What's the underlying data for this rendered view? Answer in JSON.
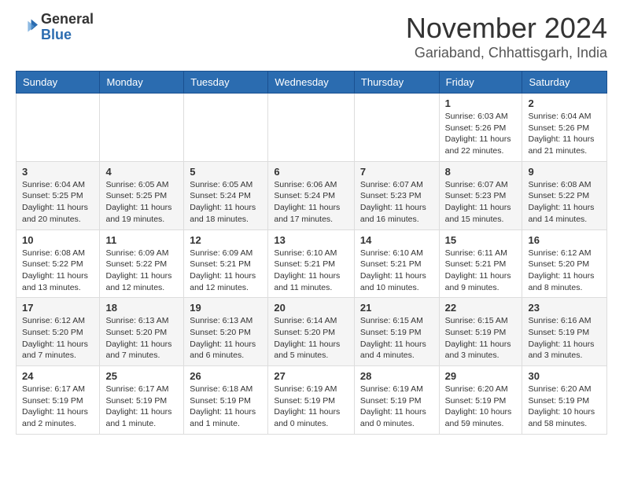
{
  "logo": {
    "general": "General",
    "blue": "Blue"
  },
  "header": {
    "month": "November 2024",
    "location": "Gariaband, Chhattisgarh, India"
  },
  "weekdays": [
    "Sunday",
    "Monday",
    "Tuesday",
    "Wednesday",
    "Thursday",
    "Friday",
    "Saturday"
  ],
  "weeks": [
    [
      {
        "day": "",
        "info": ""
      },
      {
        "day": "",
        "info": ""
      },
      {
        "day": "",
        "info": ""
      },
      {
        "day": "",
        "info": ""
      },
      {
        "day": "",
        "info": ""
      },
      {
        "day": "1",
        "info": "Sunrise: 6:03 AM\nSunset: 5:26 PM\nDaylight: 11 hours and 22 minutes."
      },
      {
        "day": "2",
        "info": "Sunrise: 6:04 AM\nSunset: 5:26 PM\nDaylight: 11 hours and 21 minutes."
      }
    ],
    [
      {
        "day": "3",
        "info": "Sunrise: 6:04 AM\nSunset: 5:25 PM\nDaylight: 11 hours and 20 minutes."
      },
      {
        "day": "4",
        "info": "Sunrise: 6:05 AM\nSunset: 5:25 PM\nDaylight: 11 hours and 19 minutes."
      },
      {
        "day": "5",
        "info": "Sunrise: 6:05 AM\nSunset: 5:24 PM\nDaylight: 11 hours and 18 minutes."
      },
      {
        "day": "6",
        "info": "Sunrise: 6:06 AM\nSunset: 5:24 PM\nDaylight: 11 hours and 17 minutes."
      },
      {
        "day": "7",
        "info": "Sunrise: 6:07 AM\nSunset: 5:23 PM\nDaylight: 11 hours and 16 minutes."
      },
      {
        "day": "8",
        "info": "Sunrise: 6:07 AM\nSunset: 5:23 PM\nDaylight: 11 hours and 15 minutes."
      },
      {
        "day": "9",
        "info": "Sunrise: 6:08 AM\nSunset: 5:22 PM\nDaylight: 11 hours and 14 minutes."
      }
    ],
    [
      {
        "day": "10",
        "info": "Sunrise: 6:08 AM\nSunset: 5:22 PM\nDaylight: 11 hours and 13 minutes."
      },
      {
        "day": "11",
        "info": "Sunrise: 6:09 AM\nSunset: 5:22 PM\nDaylight: 11 hours and 12 minutes."
      },
      {
        "day": "12",
        "info": "Sunrise: 6:09 AM\nSunset: 5:21 PM\nDaylight: 11 hours and 12 minutes."
      },
      {
        "day": "13",
        "info": "Sunrise: 6:10 AM\nSunset: 5:21 PM\nDaylight: 11 hours and 11 minutes."
      },
      {
        "day": "14",
        "info": "Sunrise: 6:10 AM\nSunset: 5:21 PM\nDaylight: 11 hours and 10 minutes."
      },
      {
        "day": "15",
        "info": "Sunrise: 6:11 AM\nSunset: 5:21 PM\nDaylight: 11 hours and 9 minutes."
      },
      {
        "day": "16",
        "info": "Sunrise: 6:12 AM\nSunset: 5:20 PM\nDaylight: 11 hours and 8 minutes."
      }
    ],
    [
      {
        "day": "17",
        "info": "Sunrise: 6:12 AM\nSunset: 5:20 PM\nDaylight: 11 hours and 7 minutes."
      },
      {
        "day": "18",
        "info": "Sunrise: 6:13 AM\nSunset: 5:20 PM\nDaylight: 11 hours and 7 minutes."
      },
      {
        "day": "19",
        "info": "Sunrise: 6:13 AM\nSunset: 5:20 PM\nDaylight: 11 hours and 6 minutes."
      },
      {
        "day": "20",
        "info": "Sunrise: 6:14 AM\nSunset: 5:20 PM\nDaylight: 11 hours and 5 minutes."
      },
      {
        "day": "21",
        "info": "Sunrise: 6:15 AM\nSunset: 5:19 PM\nDaylight: 11 hours and 4 minutes."
      },
      {
        "day": "22",
        "info": "Sunrise: 6:15 AM\nSunset: 5:19 PM\nDaylight: 11 hours and 3 minutes."
      },
      {
        "day": "23",
        "info": "Sunrise: 6:16 AM\nSunset: 5:19 PM\nDaylight: 11 hours and 3 minutes."
      }
    ],
    [
      {
        "day": "24",
        "info": "Sunrise: 6:17 AM\nSunset: 5:19 PM\nDaylight: 11 hours and 2 minutes."
      },
      {
        "day": "25",
        "info": "Sunrise: 6:17 AM\nSunset: 5:19 PM\nDaylight: 11 hours and 1 minute."
      },
      {
        "day": "26",
        "info": "Sunrise: 6:18 AM\nSunset: 5:19 PM\nDaylight: 11 hours and 1 minute."
      },
      {
        "day": "27",
        "info": "Sunrise: 6:19 AM\nSunset: 5:19 PM\nDaylight: 11 hours and 0 minutes."
      },
      {
        "day": "28",
        "info": "Sunrise: 6:19 AM\nSunset: 5:19 PM\nDaylight: 11 hours and 0 minutes."
      },
      {
        "day": "29",
        "info": "Sunrise: 6:20 AM\nSunset: 5:19 PM\nDaylight: 10 hours and 59 minutes."
      },
      {
        "day": "30",
        "info": "Sunrise: 6:20 AM\nSunset: 5:19 PM\nDaylight: 10 hours and 58 minutes."
      }
    ]
  ]
}
